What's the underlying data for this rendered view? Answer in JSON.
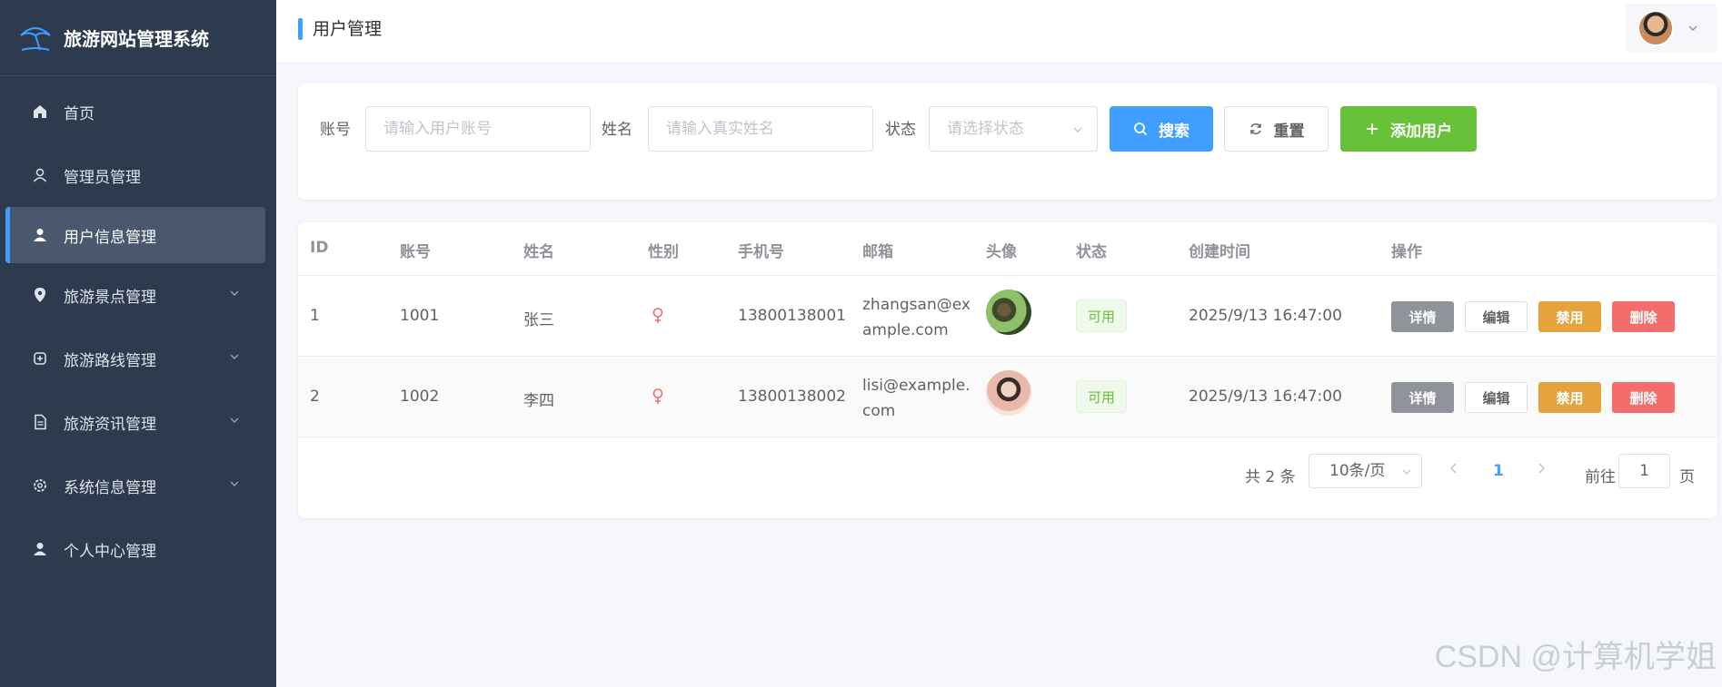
{
  "brand": {
    "title": "旅游网站管理系统"
  },
  "sidebar": {
    "items": [
      {
        "label": "首页",
        "icon": "home-icon",
        "expandable": false,
        "active": false
      },
      {
        "label": "管理员管理",
        "icon": "user-outline-icon",
        "expandable": false,
        "active": false
      },
      {
        "label": "用户信息管理",
        "icon": "user-icon",
        "expandable": false,
        "active": true
      },
      {
        "label": "旅游景点管理",
        "icon": "location-icon",
        "expandable": true,
        "active": false
      },
      {
        "label": "旅游路线管理",
        "icon": "route-icon",
        "expandable": true,
        "active": false
      },
      {
        "label": "旅游资讯管理",
        "icon": "document-icon",
        "expandable": true,
        "active": false
      },
      {
        "label": "系统信息管理",
        "icon": "gear-icon",
        "expandable": true,
        "active": false
      },
      {
        "label": "个人中心管理",
        "icon": "user-icon",
        "expandable": false,
        "active": false
      }
    ]
  },
  "header": {
    "title": "用户管理"
  },
  "filters": {
    "account_label": "账号",
    "account_placeholder": "请输入用户账号",
    "name_label": "姓名",
    "name_placeholder": "请输入真实姓名",
    "status_label": "状态",
    "status_placeholder": "请选择状态",
    "search_label": "搜索",
    "reset_label": "重置",
    "add_label": "添加用户"
  },
  "table": {
    "columns": [
      "ID",
      "账号",
      "姓名",
      "性别",
      "手机号",
      "邮箱",
      "头像",
      "状态",
      "创建时间",
      "操作"
    ],
    "rows": [
      {
        "id": "1",
        "account": "1001",
        "name": "张三",
        "gender_icon": "female-icon",
        "phone": "13800138001",
        "email": "zhangsan@example.com",
        "status": "可用",
        "created": "2025/9/13 16:47:00"
      },
      {
        "id": "2",
        "account": "1002",
        "name": "李四",
        "gender_icon": "female-icon",
        "phone": "13800138002",
        "email": "lisi@example.com",
        "status": "可用",
        "created": "2025/9/13 16:47:00"
      }
    ],
    "actions": {
      "detail": "详情",
      "edit": "编辑",
      "ban": "禁用",
      "delete": "删除"
    }
  },
  "pagination": {
    "total_text": "共 2 条",
    "page_size": "10条/页",
    "current_page": "1",
    "goto_label": "前往",
    "goto_value": "1",
    "goto_unit": "页"
  },
  "watermark": "CSDN @计算机学姐",
  "colors": {
    "primary": "#409eff",
    "success": "#67c23a",
    "warning": "#e6a23c",
    "danger": "#f56c6c",
    "info": "#909399",
    "sidebar": "#2e3b4e"
  }
}
